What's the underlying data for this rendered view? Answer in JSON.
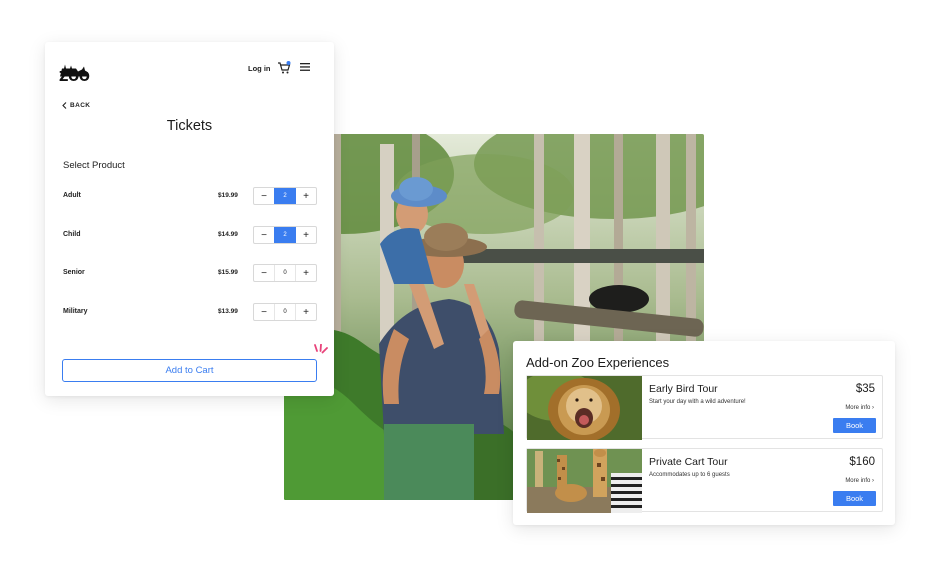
{
  "header": {
    "logo_text": "ZOO",
    "login_label": "Log in",
    "cart_icon": "cart-icon",
    "menu_icon": "menu-icon"
  },
  "tickets": {
    "back_label": "BACK",
    "title": "Tickets",
    "select_label": "Select Product",
    "rows": [
      {
        "name": "Adult",
        "price": "$19.99",
        "qty": "2"
      },
      {
        "name": "Child",
        "price": "$14.99",
        "qty": "2"
      },
      {
        "name": "Senior",
        "price": "$15.99",
        "qty": "0"
      },
      {
        "name": "Military",
        "price": "$13.99",
        "qty": "0"
      }
    ],
    "minus_label": "−",
    "plus_label": "+",
    "add_to_cart_label": "Add to Cart"
  },
  "addons": {
    "title": "Add-on Zoo Experiences",
    "items": [
      {
        "title": "Early Bird Tour",
        "desc": "Start your day with a wild adventure!",
        "price": "$35",
        "more": "More info ›",
        "book": "Book"
      },
      {
        "title": "Private Cart Tour",
        "desc": "Accommodates up to 6 guests",
        "price": "$160",
        "more": "More info ›",
        "book": "Book"
      }
    ]
  },
  "colors": {
    "accent": "#3a7df0",
    "sparkle": "#e8437a"
  }
}
